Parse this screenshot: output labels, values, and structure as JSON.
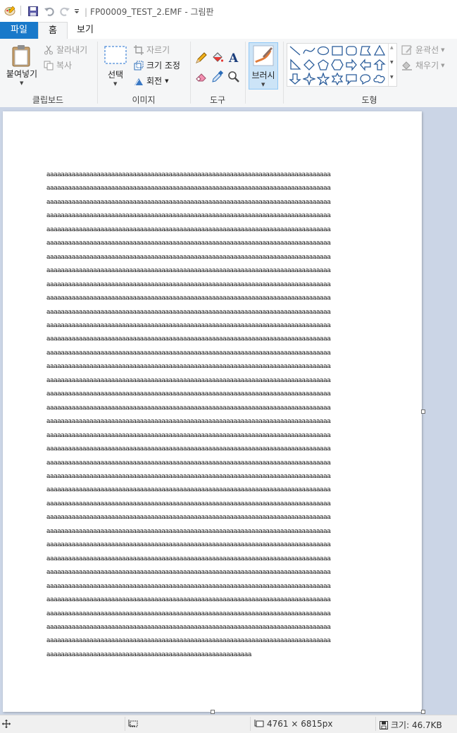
{
  "titlebar": {
    "title": "FP00009_TEST_2.EMF - 그림판",
    "qat_separator": "|"
  },
  "tabs": {
    "file": "파일",
    "home": "홈",
    "view": "보기"
  },
  "clipboard": {
    "paste": "붙여넣기",
    "cut": "잘라내기",
    "copy": "복사",
    "group_label": "클립보드"
  },
  "image": {
    "select": "선택",
    "crop": "자르기",
    "resize": "크기 조정",
    "rotate": "회전",
    "group_label": "이미지"
  },
  "tools": {
    "group_label": "도구"
  },
  "brush": {
    "label": "브러시"
  },
  "shapes": {
    "outline": "윤곽선",
    "fill": "채우기",
    "group_label": "도형"
  },
  "document": {
    "full_line": "aaaaaaaaaaaaaaaaaaaaaaaaaaaaaaaaaaaaaaaaaaaaaaaaaaaaaaaaaaaaaaaaaaaaaaaaaaaaaaa",
    "full_line_count": 35,
    "last_line": "aaaaaaaaaaaaaaaaaaaaaaaaaaaaaaaaaaaaaaaaaaaaaaaaaaaaaaaaa"
  },
  "status": {
    "dimensions": "4761 × 6815px",
    "size": "크기: 46.7KB"
  },
  "colors": {
    "file_tab": "#1979ca",
    "canvas_bg": "#cbd5e6",
    "ribbon_bg": "#f5f6f7",
    "brush_selected": "#cce4f7"
  }
}
